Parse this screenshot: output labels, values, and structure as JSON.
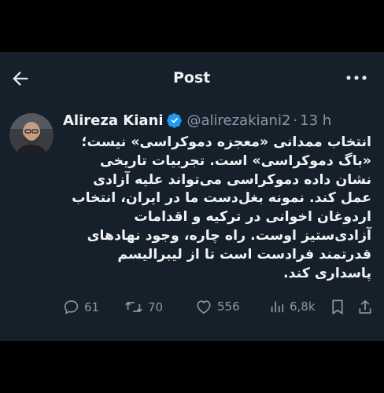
{
  "header": {
    "title": "Post"
  },
  "tweet": {
    "author_name": "Alireza Kiani",
    "handle": "@alirezakiani2",
    "separator": "·",
    "time": "13 h",
    "text": "انتخاب ممدانی «معجزه دموکراسی» نیست؛ «باگ دموکراسی» است. تجربیات تاریخی نشان داده دموکراسی می‌تواند علیه آزادی عمل کند. نمونه بغل‌دست ما در ایران، انتخاب اردوغان اخوانی در ترکیه و اقدامات آزادی‌ستیز اوست. راه چاره، وجود نهادهای قدرتمند فرادست است تا از لیبرالیسم پاسداری کند."
  },
  "actions": {
    "replies": "61",
    "reposts": "70",
    "likes": "556",
    "views": "6,8k"
  },
  "icons": [
    "back-arrow-icon",
    "more-icon",
    "verified-icon",
    "reply-icon",
    "repost-icon",
    "like-icon",
    "views-icon",
    "bookmark-icon",
    "share-icon"
  ],
  "colors": {
    "background": "#15202b",
    "text": "#e7e9ea",
    "muted": "#8b98a5",
    "verified": "#1d9bf0"
  }
}
